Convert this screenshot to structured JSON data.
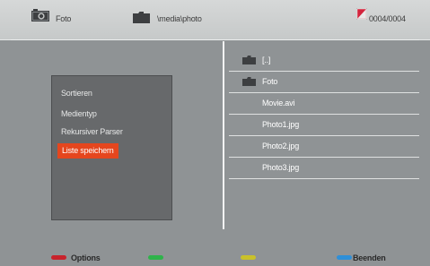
{
  "header": {
    "source_label": "Foto",
    "path": "\\media\\photo",
    "counter": "0004/0004",
    "icons": [
      "camera-icon",
      "folder-icon",
      "document-icon"
    ]
  },
  "menu": {
    "items": [
      "Sortieren",
      "Medientyp",
      "Rekursiver Parser",
      "Liste speichern"
    ],
    "selected": "Liste speichern"
  },
  "files": [
    {
      "name": "[..]",
      "icon": "folder-icon"
    },
    {
      "name": "Foto",
      "icon": "folder-icon"
    },
    {
      "name": "Movie.avi",
      "icon": ""
    },
    {
      "name": "Photo1.jpg",
      "icon": ""
    },
    {
      "name": "Photo2.jpg",
      "icon": ""
    },
    {
      "name": "Photo3.jpg",
      "icon": ""
    }
  ],
  "footer": {
    "red_label": "Options",
    "green_label": "",
    "yellow_label": "",
    "blue_label": "Beenden"
  },
  "colors": {
    "red": "#c8232c",
    "green": "#2fb34a",
    "yellow": "#c9c12a",
    "blue": "#2e8fd8",
    "selection": "#e5461e"
  }
}
